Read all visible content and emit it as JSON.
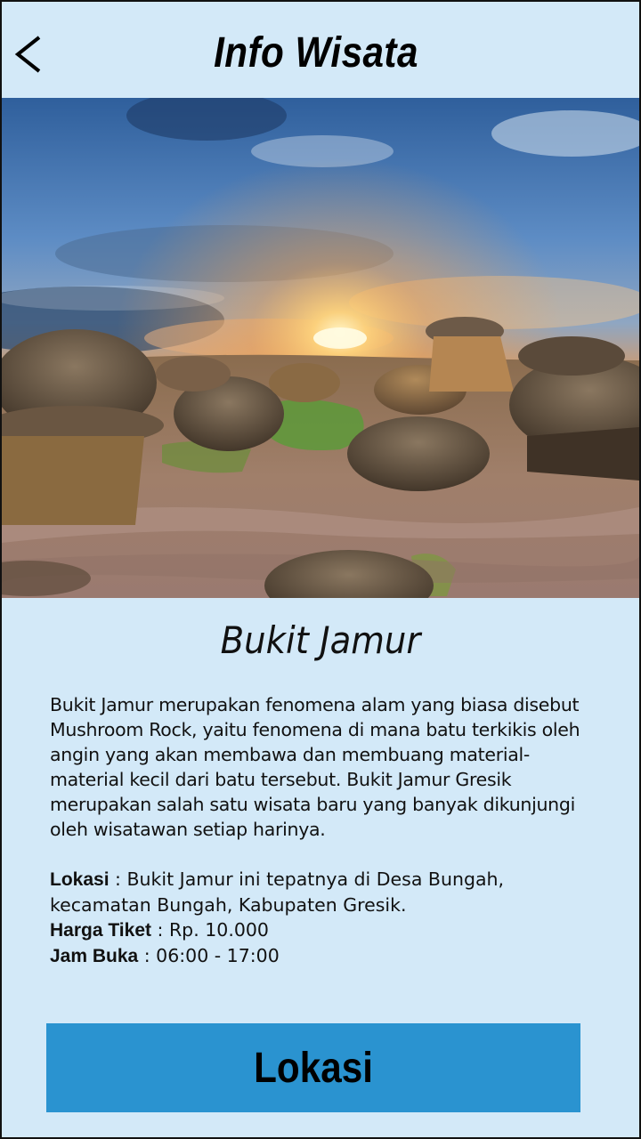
{
  "header": {
    "title": "Info Wisata",
    "back_icon": "chevron-left-icon"
  },
  "hero_image": {
    "alt": "Bukit Jamur"
  },
  "place": {
    "name": "Bukit Jamur",
    "description": "Bukit Jamur merupakan fenomena alam yang biasa disebut Mushroom Rock, yaitu fenomena di mana batu terkikis oleh angin yang akan membawa dan membuang material-material kecil dari batu tersebut. Bukit Jamur Gresik merupakan salah satu wisata baru yang banyak dikunjungi oleh wisatawan setiap harinya.",
    "lokasi_label": "Lokasi",
    "lokasi_value": " : Bukit Jamur ini tepatnya di Desa Bungah, kecamatan Bungah,   Kabupaten Gresik.",
    "harga_label": "Harga Tiket",
    "harga_value": " : Rp. 10.000",
    "jam_label": "Jam Buka",
    "jam_value": " :  06:00 - 17:00"
  },
  "actions": {
    "lokasi_button": "Lokasi"
  },
  "colors": {
    "background": "#d3e9f8",
    "button": "#2a93d0"
  }
}
